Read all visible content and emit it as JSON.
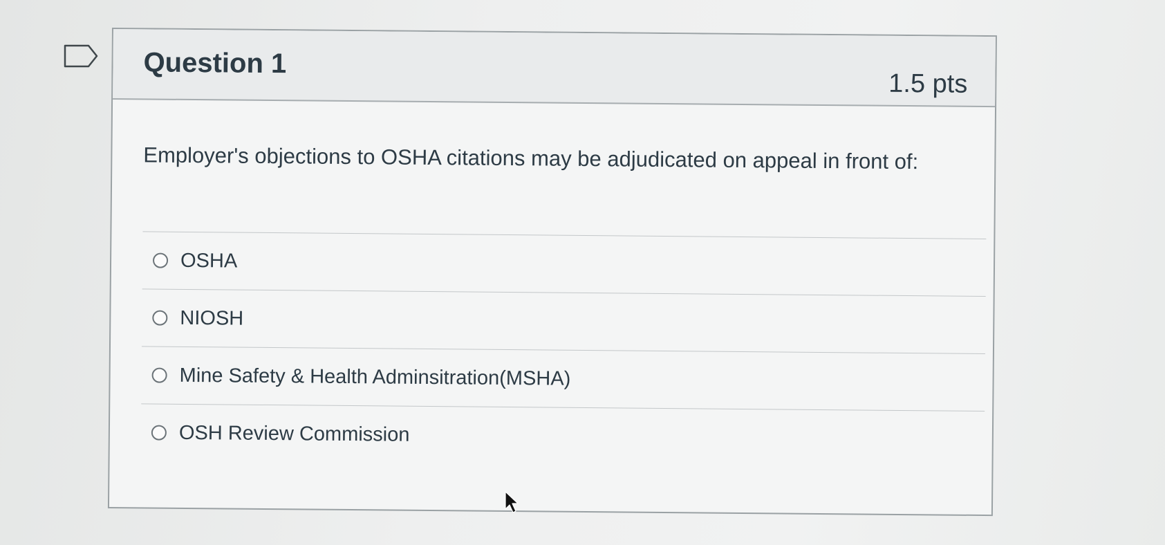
{
  "question": {
    "title": "Question 1",
    "points": "1.5 pts",
    "text": "Employer's objections to OSHA citations may be adjudicated on appeal in front of:",
    "flag_icon": "flag-question-icon"
  },
  "answers": [
    {
      "label": "OSHA",
      "selected": false
    },
    {
      "label": "NIOSH",
      "selected": false
    },
    {
      "label": "Mine Safety & Health Adminsitration(MSHA)",
      "selected": false
    },
    {
      "label": "OSH Review Commission",
      "selected": false
    }
  ],
  "cursor_icon": "mouse-pointer-icon"
}
